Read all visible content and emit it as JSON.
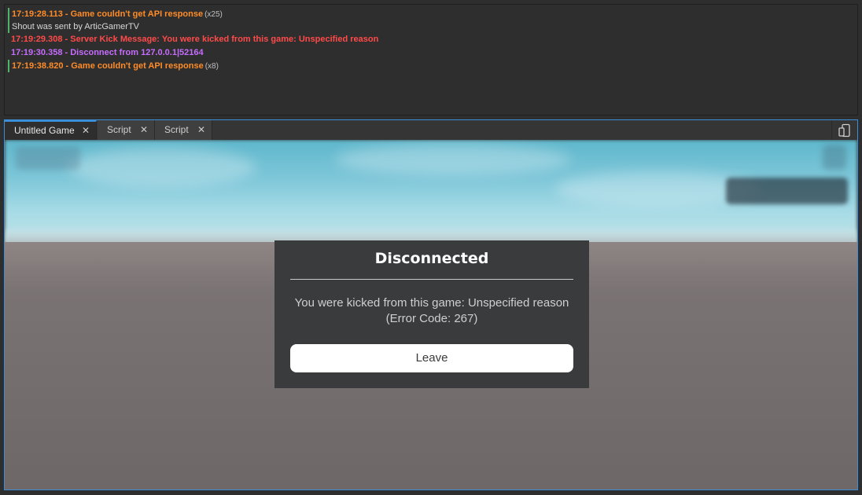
{
  "output_log": [
    {
      "time": "17:19:28.113",
      "message": "Game couldn't get API response",
      "count": "(x25)",
      "level": "warn",
      "marked": true
    },
    {
      "time": "",
      "message": "Shout was sent by ArticGamerTV",
      "count": "",
      "level": "info",
      "marked": true
    },
    {
      "time": "17:19:29.308",
      "message": "Server Kick Message: You were kicked from this game: Unspecified reason",
      "count": "",
      "level": "error",
      "marked": false
    },
    {
      "time": "17:19:30.358",
      "message": "Disconnect from 127.0.0.1|52164",
      "count": "",
      "level": "purple",
      "marked": false
    },
    {
      "time": "17:19:38.820",
      "message": "Game couldn't get API response",
      "count": "(x8)",
      "level": "warn",
      "marked": true
    }
  ],
  "tabs": [
    {
      "label": "Untitled Game",
      "active": true
    },
    {
      "label": "Script",
      "active": false
    },
    {
      "label": "Script",
      "active": false
    }
  ],
  "tab_close_glyph": "✕",
  "device_icon": "device-emulator-icon",
  "dialog": {
    "title": "Disconnected",
    "message_line1": "You were kicked from this game: Unspecified reason",
    "message_line2": "(Error Code: 267)",
    "leave_label": "Leave"
  },
  "colors": {
    "warn": "#ff8c28",
    "error": "#ff4a4a",
    "purple": "#c76cff",
    "accent": "#3a8fd8"
  }
}
